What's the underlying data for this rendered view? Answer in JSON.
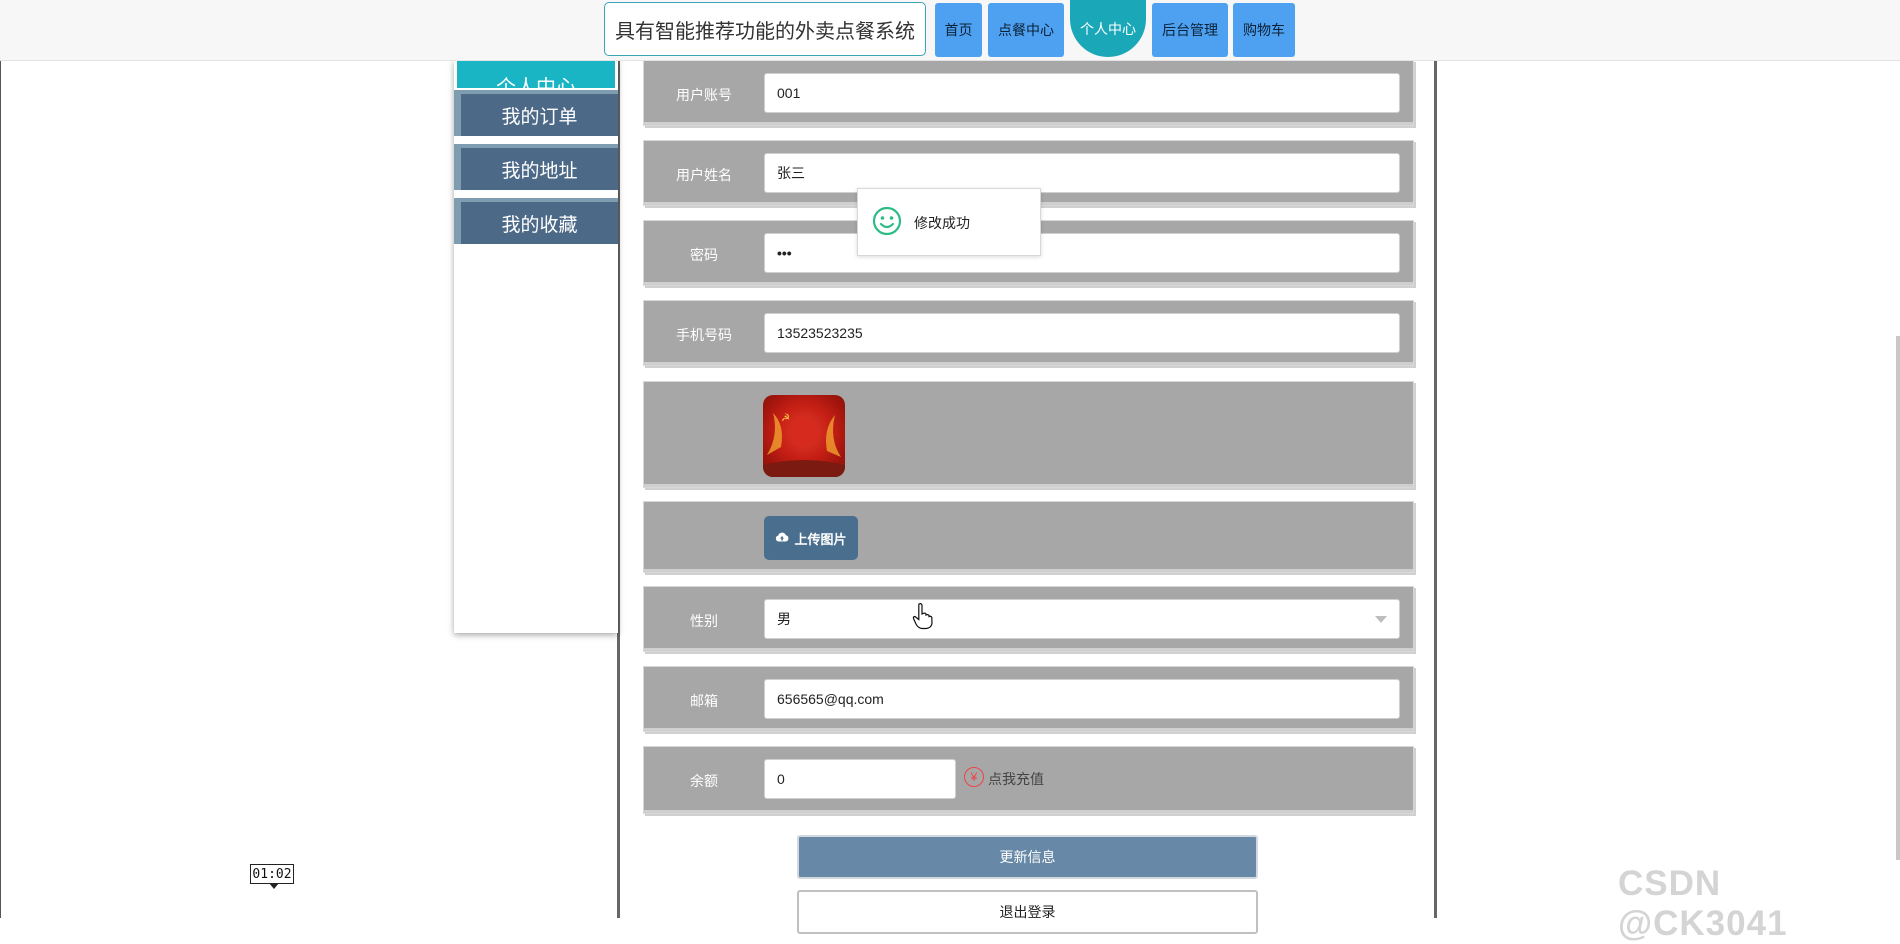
{
  "header": {
    "site_title": "具有智能推荐功能的外卖点餐系统",
    "nav": [
      {
        "label": "首页"
      },
      {
        "label": "点餐中心"
      },
      {
        "label": "个人中心",
        "active": true
      },
      {
        "label": "后台管理"
      },
      {
        "label": "购物车"
      }
    ]
  },
  "sidebar": {
    "heading": "个人中心",
    "items": [
      {
        "label": "我的订单"
      },
      {
        "label": "我的地址"
      },
      {
        "label": "我的收藏"
      }
    ]
  },
  "form": {
    "account": {
      "label": "用户账号",
      "value": "001"
    },
    "name": {
      "label": "用户姓名",
      "value": "张三"
    },
    "password": {
      "label": "密码",
      "value": "•••"
    },
    "phone": {
      "label": "手机号码",
      "value": "13523523235"
    },
    "upload_label": "上传图片",
    "gender": {
      "label": "性别",
      "value": "男"
    },
    "email": {
      "label": "邮箱",
      "value": "656565@qq.com"
    },
    "balance": {
      "label": "余额",
      "value": "0",
      "recharge": "点我充值"
    }
  },
  "buttons": {
    "update": "更新信息",
    "logout": "退出登录"
  },
  "toast": {
    "message": "修改成功",
    "icon": "smile-icon"
  },
  "video_timestamp": "01:02",
  "watermark": "CSDN @CK3041",
  "colors": {
    "accent": "#1aa7b8",
    "nav_button": "#4ea1f0",
    "sidebar_item": "#4c6a88",
    "row_bg": "#a7a7a7",
    "update_button": "#6788a6"
  }
}
